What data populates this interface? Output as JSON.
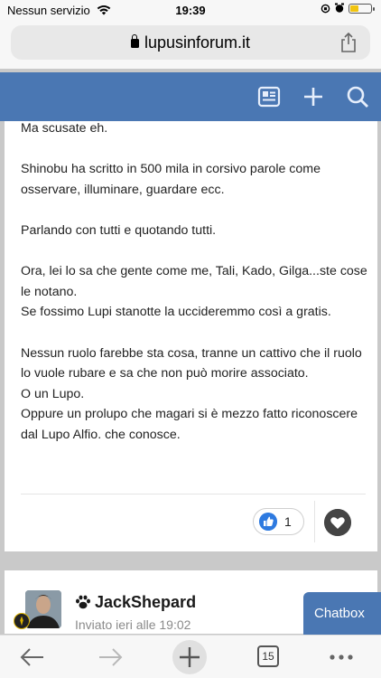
{
  "statusbar": {
    "carrier": "Nessun servizio",
    "time": "19:39"
  },
  "browser": {
    "url": "lupusinforum.it",
    "tab_count": "15"
  },
  "site": {
    "header_color": "#4a77b3"
  },
  "post": {
    "paragraphs": [
      "Ma scusate eh.",
      "Shinobu ha scritto in 500 mila in corsivo parole come osservare, illuminare, guardare ecc.",
      "Parlando con tutti e quotando tutti.",
      "Ora, lei lo sa che gente come me, Tali, Kado, Gilga...ste cose le notano.\nSe fossimo Lupi stanotte la uccideremmo così a gratis.",
      "Nessun ruolo farebbe sta cosa, tranne un cattivo che il ruolo lo vuole rubare e sa che non può morire associato.\nO un Lupo.\nOppure un prolupo che magari si è mezzo fatto riconoscere dal Lupo Alfio. che conosce."
    ],
    "like_count": "1"
  },
  "next_post": {
    "username": "JackShepard",
    "posted": "Inviato ieri alle 19:02"
  },
  "chatbox_label": "Chatbox",
  "icons": [
    "wifi-icon",
    "alarm-icon",
    "battery-icon",
    "lock-icon",
    "share-icon",
    "forum-list-icon",
    "plus-icon",
    "search-icon",
    "like-icon",
    "heart-icon",
    "paw-icon",
    "back-icon",
    "forward-icon",
    "new-tab-icon",
    "tabs-icon",
    "more-icon"
  ]
}
